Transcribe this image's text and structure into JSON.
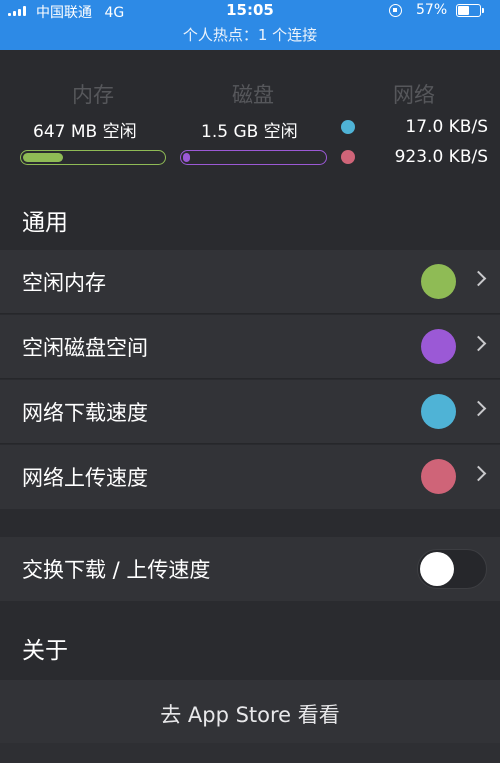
{
  "status_bar": {
    "carrier": "中国联通",
    "network": "4G",
    "time": "15:05",
    "battery_percent_text": "57%",
    "battery_level": 0.57,
    "hotspot_text": "个人热点：1 个连接",
    "background_color": "#2d8ae6"
  },
  "stats": {
    "memory": {
      "title": "内存",
      "value": "647 MB 空闲",
      "fill_fraction": 0.29,
      "color": "#8fbb55"
    },
    "disk": {
      "title": "磁盘",
      "value": "1.5 GB 空闲",
      "fill_fraction": 0.05,
      "color": "#9b59d6"
    },
    "network": {
      "title": "网络",
      "download": {
        "value": "17.0 KB/S",
        "color": "#4fb3d6"
      },
      "upload": {
        "value": "923.0 KB/S",
        "color": "#cf6478"
      }
    }
  },
  "general": {
    "header": "通用",
    "items": [
      {
        "label": "空闲内存",
        "color": "#8fbb55"
      },
      {
        "label": "空闲磁盘空间",
        "color": "#9b59d6"
      },
      {
        "label": "网络下载速度",
        "color": "#4fb3d6"
      },
      {
        "label": "网络上传速度",
        "color": "#cf6478"
      }
    ]
  },
  "swap": {
    "label": "交换下载 / 上传速度",
    "enabled": false
  },
  "about": {
    "header": "关于",
    "app_store_label": "去 App Store 看看"
  }
}
